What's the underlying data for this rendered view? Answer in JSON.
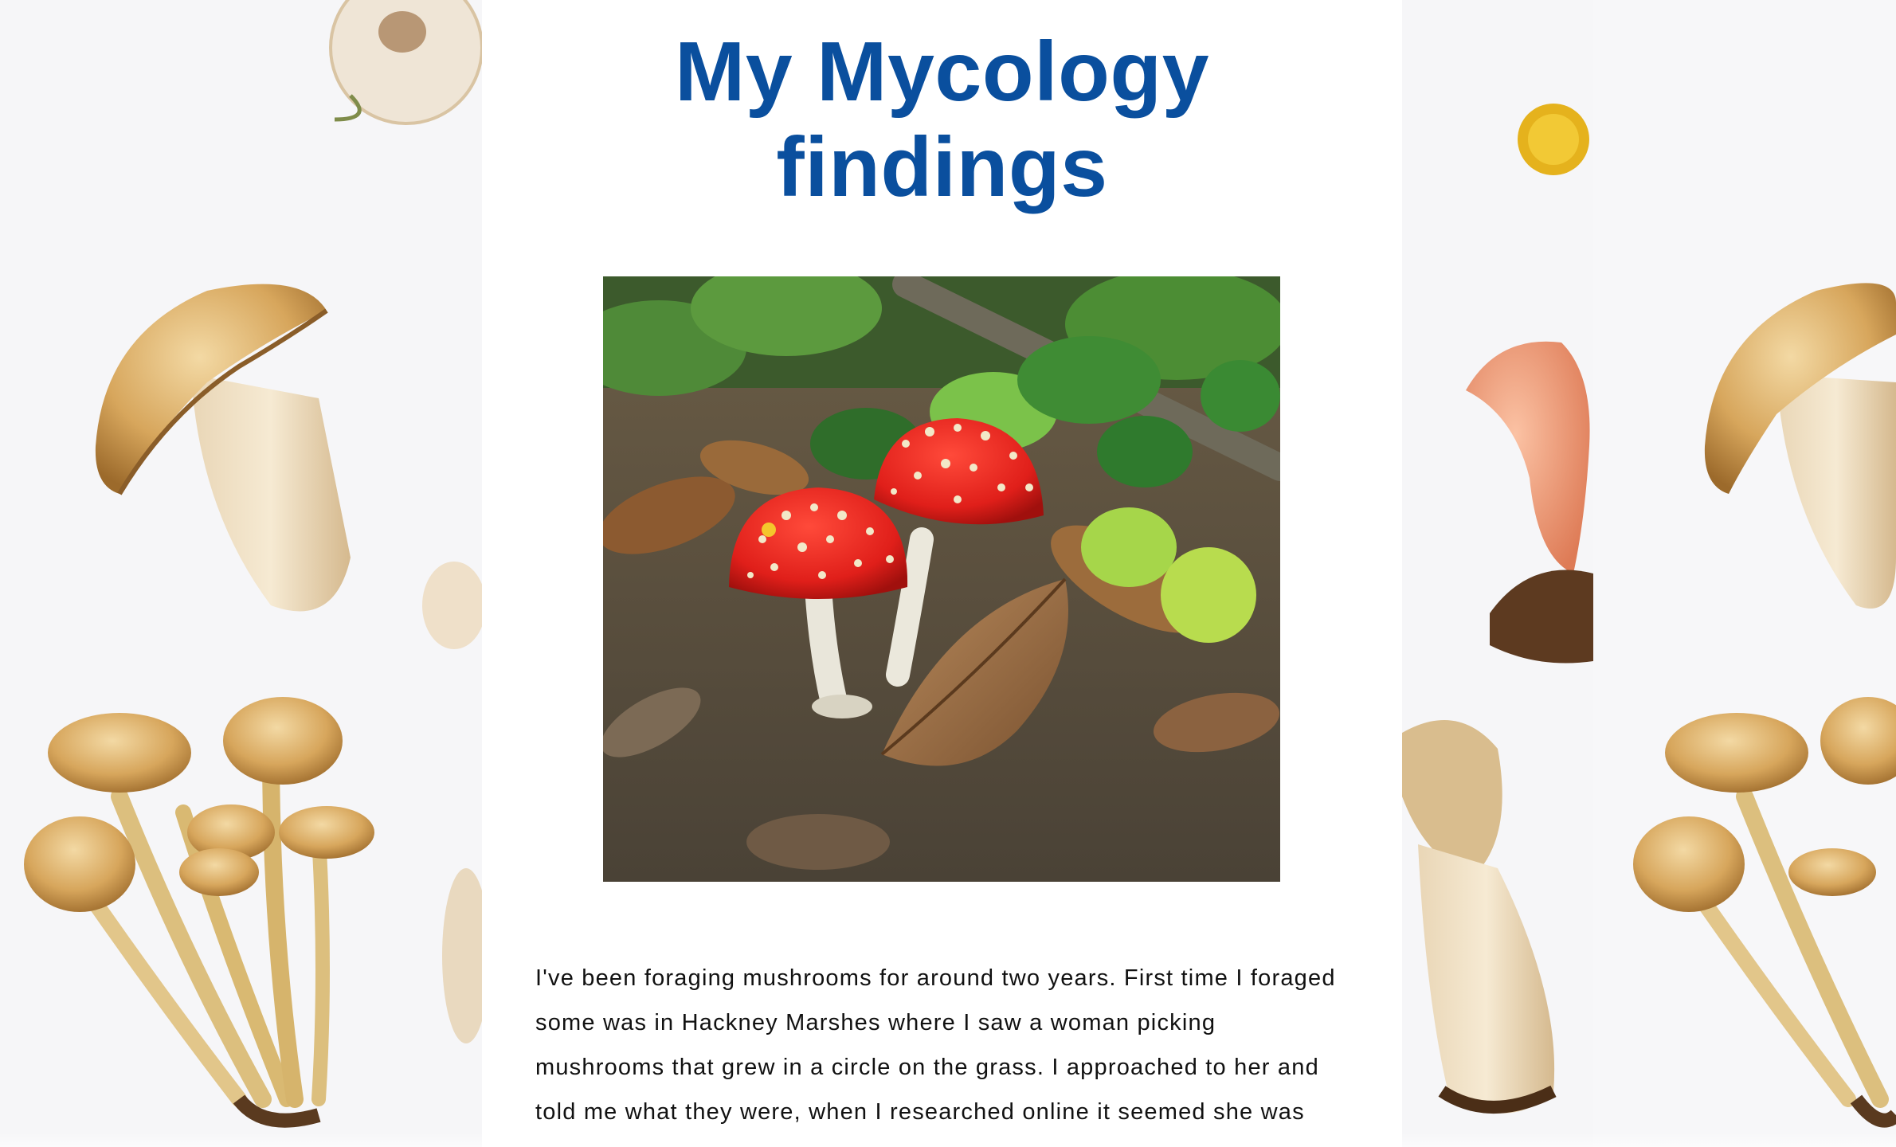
{
  "page": {
    "title_line1": "My Mycology",
    "title_line2": "findings",
    "paragraph": "I've been foraging mushrooms for around two years. First time I foraged some was in Hackney Marshes where I saw a woman picking mushrooms that grew in a circle on the grass. I approached to her and told me what they were, when I researched online it seemed she was"
  },
  "photo": {
    "subject": "fly-agaric-mushrooms-photo"
  },
  "background": {
    "pattern": "mushroom-illustrations"
  },
  "colors": {
    "title": "#0a4f9e",
    "card": "#ffffff",
    "page_bg": "#f6f6f8"
  }
}
